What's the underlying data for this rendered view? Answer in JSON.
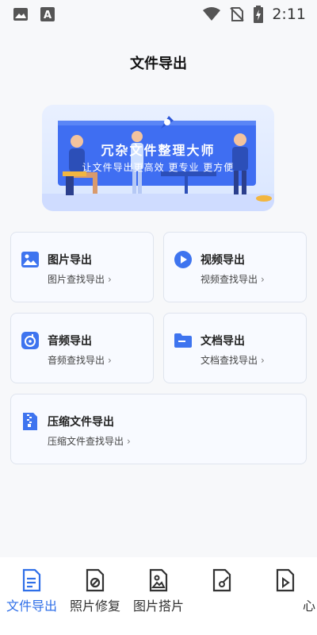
{
  "status_bar": {
    "time": "2:11",
    "icons": [
      "image-icon",
      "text-a-icon",
      "wifi-icon",
      "no-sim-icon",
      "battery-charging-icon"
    ]
  },
  "header": {
    "title": "文件导出"
  },
  "banner": {
    "title": "冗杂文件整理大师",
    "subtitle": "让文件导出更高效  更专业  更方便"
  },
  "cards": [
    {
      "title": "图片导出",
      "subtitle": "图片查找导出",
      "icon": "image-icon"
    },
    {
      "title": "视频导出",
      "subtitle": "视频查找导出",
      "icon": "play-icon"
    },
    {
      "title": "音频导出",
      "subtitle": "音频查找导出",
      "icon": "audio-icon"
    },
    {
      "title": "文档导出",
      "subtitle": "文档查找导出",
      "icon": "folder-icon"
    },
    {
      "title": "压缩文件导出",
      "subtitle": "压缩文件查找导出",
      "icon": "zip-icon"
    }
  ],
  "bottom_nav": {
    "items": [
      {
        "label": "文件导出",
        "active": true
      },
      {
        "label": "照片修复",
        "active": false
      },
      {
        "label": "图片搭片",
        "active": false
      },
      {
        "label": "",
        "active": false
      },
      {
        "label": "心",
        "active": false
      }
    ]
  },
  "colors": {
    "accent": "#2f6fe8",
    "banner": "#3d6df2",
    "background": "#f7f8fa"
  }
}
